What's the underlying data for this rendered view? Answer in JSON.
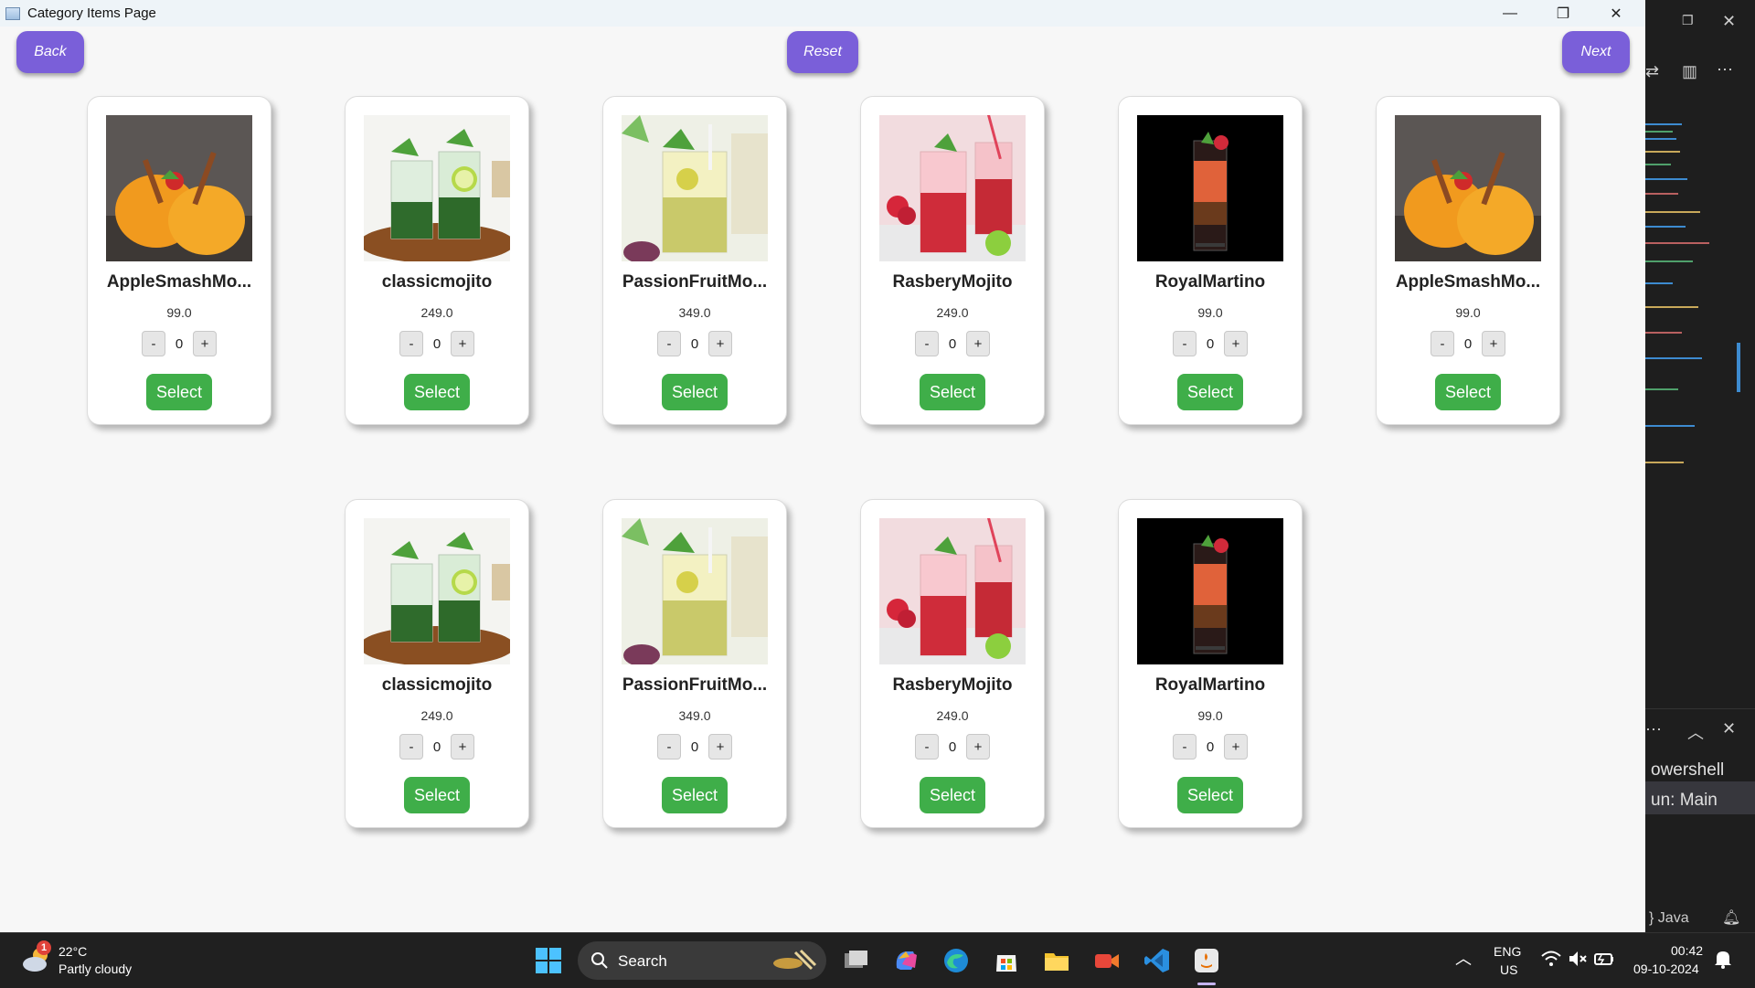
{
  "window": {
    "title": "Category Items Page",
    "controls": {
      "minimize": "—",
      "maximize": "❐",
      "close": "✕"
    }
  },
  "toolbar": {
    "back_label": "Back",
    "reset_label": "Reset",
    "next_label": "Next"
  },
  "items": [
    {
      "name": "AppleSmashMo...",
      "price": "99.0",
      "qty": "0",
      "minus": "-",
      "plus": "+",
      "select": "Select",
      "image": "orange-cocktail-glasses"
    },
    {
      "name": "classicmojito",
      "price": "249.0",
      "qty": "0",
      "minus": "-",
      "plus": "+",
      "select": "Select",
      "image": "mint-lime-mojito"
    },
    {
      "name": "PassionFruitMo...",
      "price": "349.0",
      "qty": "0",
      "minus": "-",
      "plus": "+",
      "select": "Select",
      "image": "passion-fruit-mojito"
    },
    {
      "name": "RasberyMojito",
      "price": "249.0",
      "qty": "0",
      "minus": "-",
      "plus": "+",
      "select": "Select",
      "image": "raspberry-mojito"
    },
    {
      "name": "RoyalMartino",
      "price": "99.0",
      "qty": "0",
      "minus": "-",
      "plus": "+",
      "select": "Select",
      "image": "red-cocktail-black-bg"
    },
    {
      "name": "AppleSmashMo...",
      "price": "99.0",
      "qty": "0",
      "minus": "-",
      "plus": "+",
      "select": "Select",
      "image": "orange-cocktail-glasses"
    },
    {
      "name": "classicmojito",
      "price": "249.0",
      "qty": "0",
      "minus": "-",
      "plus": "+",
      "select": "Select",
      "image": "mint-lime-mojito"
    },
    {
      "name": "PassionFruitMo...",
      "price": "349.0",
      "qty": "0",
      "minus": "-",
      "plus": "+",
      "select": "Select",
      "image": "passion-fruit-mojito"
    },
    {
      "name": "RasberyMojito",
      "price": "249.0",
      "qty": "0",
      "minus": "-",
      "plus": "+",
      "select": "Select",
      "image": "raspberry-mojito"
    },
    {
      "name": "RoyalMartino",
      "price": "99.0",
      "qty": "0",
      "minus": "-",
      "plus": "+",
      "select": "Select",
      "image": "red-cocktail-black-bg"
    }
  ],
  "editor": {
    "terminal_line1": "owershell",
    "terminal_line2": "un: Main",
    "status_lang": "} Java"
  },
  "taskbar": {
    "weather_temp": "22°C",
    "weather_desc": "Partly cloudy",
    "weather_badge": "1",
    "search_label": "Search",
    "lang_line1": "ENG",
    "lang_line2": "US",
    "time": "00:42",
    "date": "09-10-2024"
  },
  "colors": {
    "nav_button": "#7a5fd9",
    "select_button": "#3fae49",
    "card_bg": "#ffffff",
    "taskbar_bg": "#202020"
  }
}
